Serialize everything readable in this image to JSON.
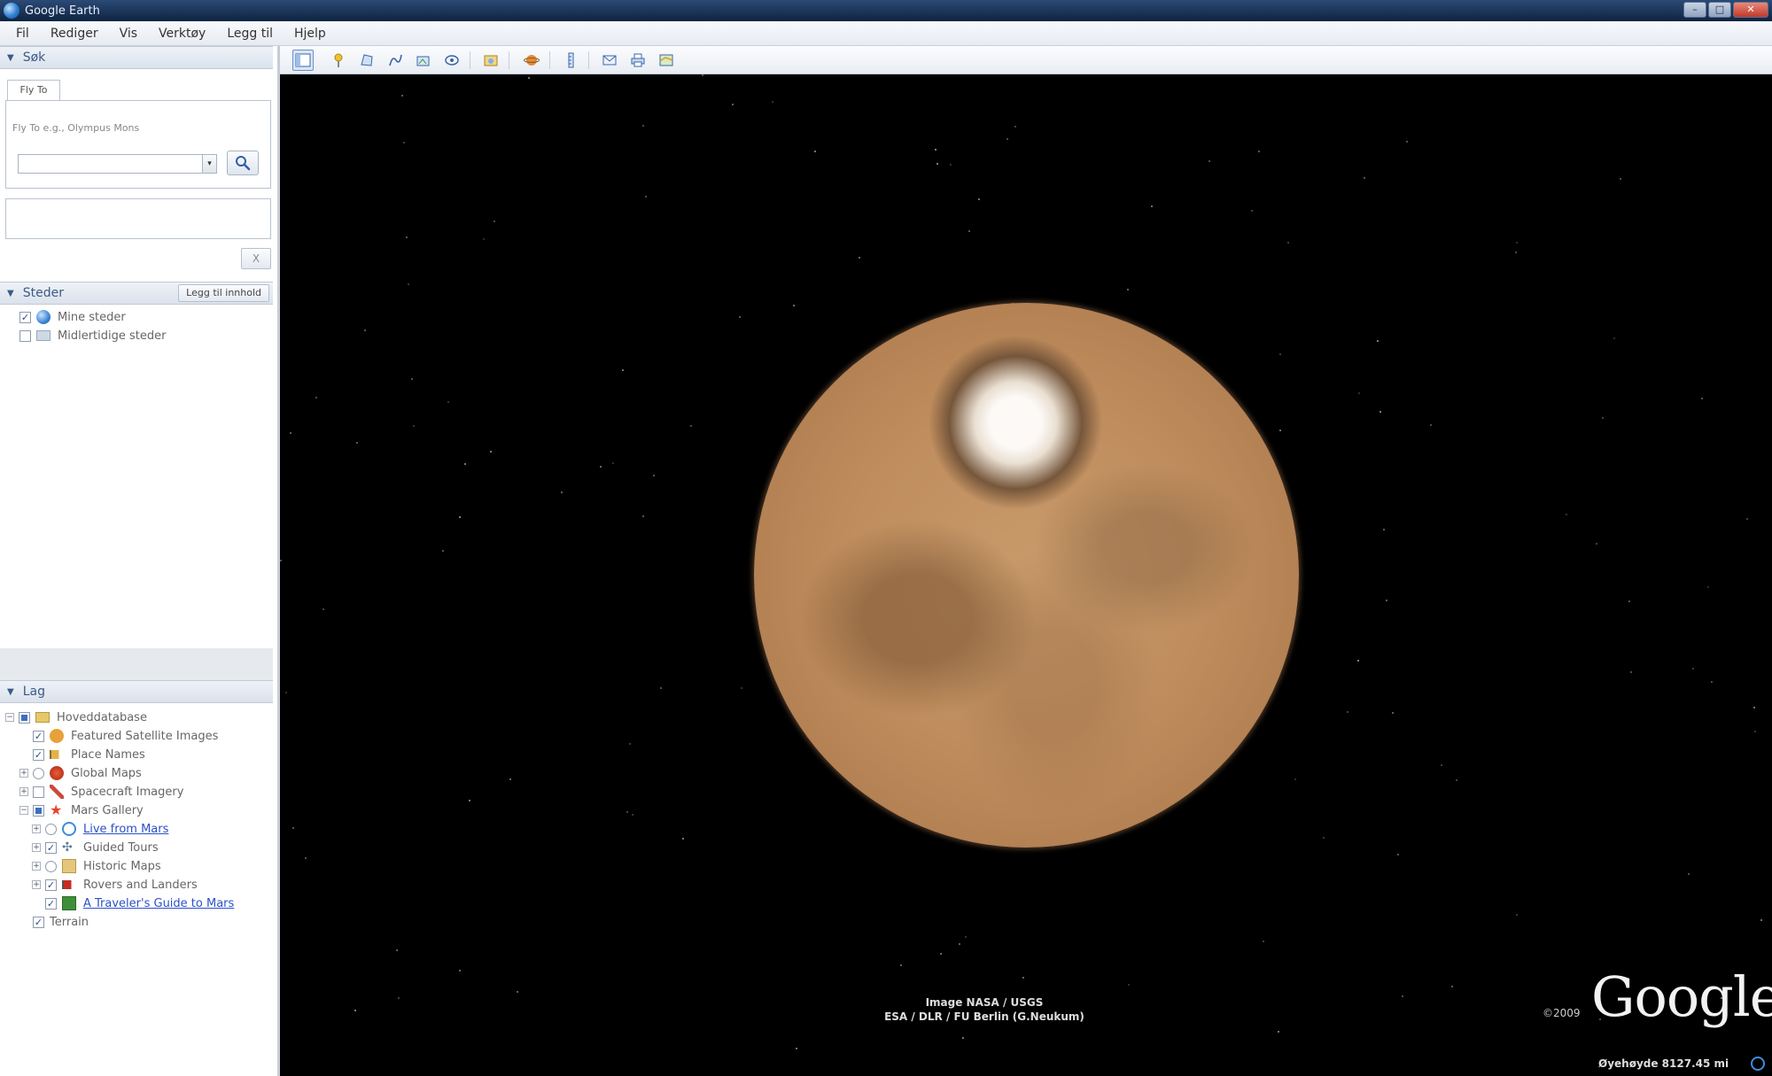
{
  "window": {
    "title": "Google Earth",
    "controls": [
      "–",
      "□",
      "✕"
    ]
  },
  "menu": [
    "Fil",
    "Rediger",
    "Vis",
    "Verktøy",
    "Legg til",
    "Hjelp"
  ],
  "search": {
    "header": "Søk",
    "tab": "Fly To",
    "hint": "Fly To e.g., Olympus Mons",
    "input_value": "",
    "dropdown_glyph": "▾",
    "clear_label": "X"
  },
  "places": {
    "header": "Steder",
    "add_content_label": "Legg til innhold",
    "items": [
      {
        "label": "Mine steder"
      },
      {
        "label": "Midlertidige steder"
      }
    ]
  },
  "layers": {
    "header": "Lag",
    "items": [
      {
        "label": "Hoveddatabase"
      },
      {
        "label": "Featured Satellite Images"
      },
      {
        "label": "Place Names"
      },
      {
        "label": "Global Maps"
      },
      {
        "label": "Spacecraft Imagery"
      },
      {
        "label": "Mars Gallery"
      },
      {
        "label": "Live from Mars"
      },
      {
        "label": "Guided Tours"
      },
      {
        "label": "Historic Maps"
      },
      {
        "label": "Rovers and Landers"
      },
      {
        "label": "A Traveler's Guide to Mars"
      },
      {
        "label": "Terrain"
      }
    ]
  },
  "view": {
    "attribution_line1": "Image NASA / USGS",
    "attribution_line2": "ESA / DLR / FU Berlin (G.Neukum)",
    "copyright": "©2009",
    "logo": "Google",
    "status": "Øyehøyde  8127.45 mi"
  },
  "colors": {
    "panel_header": "#3c5a86",
    "link": "#2b50c8",
    "mars": "#c08e5e"
  }
}
